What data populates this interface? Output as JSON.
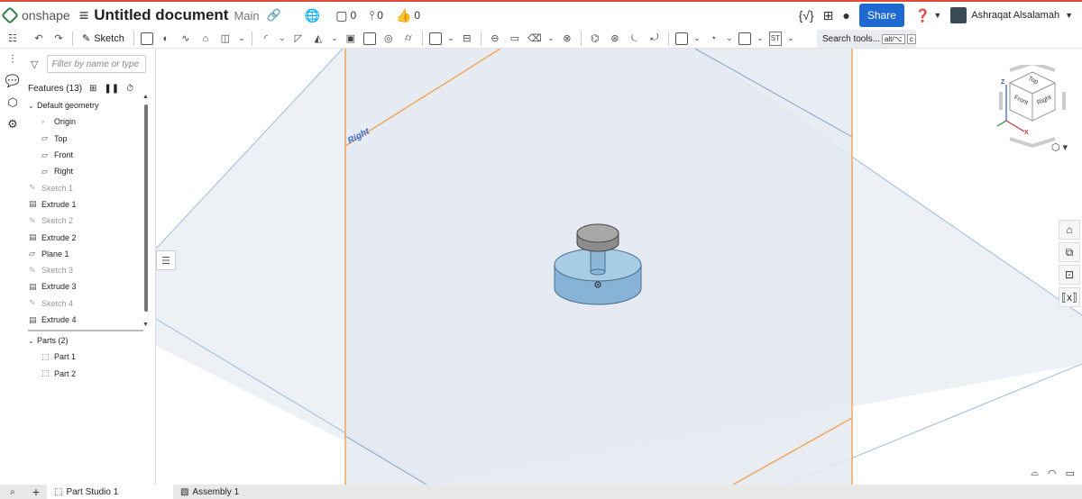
{
  "topbar": {
    "brand": "onshape",
    "doc_title": "Untitled document",
    "branch": "Main",
    "versions_count": "0",
    "branches_count": "0",
    "likes_count": "0",
    "share_label": "Share",
    "help_icon": "?",
    "user_name": "Ashraqat Alsalamah"
  },
  "toolbar": {
    "sketch_label": "Sketch",
    "search_label": "Search tools...",
    "search_kbd_1": "alt/⌥",
    "search_kbd_2": "c",
    "st_label": "ST"
  },
  "panel": {
    "filter_placeholder": "Filter by name or type",
    "features_label": "Features (13)",
    "default_geometry_label": "Default geometry",
    "default_items": [
      "Origin",
      "Top",
      "Front",
      "Right"
    ],
    "features": [
      {
        "label": "Sketch 1",
        "type": "sketch"
      },
      {
        "label": "Extrude 1",
        "type": "extrude"
      },
      {
        "label": "Sketch 2",
        "type": "sketch"
      },
      {
        "label": "Extrude 2",
        "type": "extrude"
      },
      {
        "label": "Plane 1",
        "type": "plane"
      },
      {
        "label": "Sketch 3",
        "type": "sketch"
      },
      {
        "label": "Extrude 3",
        "type": "extrude"
      },
      {
        "label": "Sketch 4",
        "type": "sketch"
      },
      {
        "label": "Extrude 4",
        "type": "extrude"
      }
    ],
    "parts_label": "Parts (2)",
    "parts": [
      "Part 1",
      "Part 2"
    ]
  },
  "viewport": {
    "plane_label": "Right",
    "cube_labels": {
      "top": "Top",
      "front": "Front",
      "right": "Right",
      "axis_z": "Z",
      "axis_x": "X"
    }
  },
  "tabs": [
    {
      "label": "Part Studio 1",
      "active": true
    },
    {
      "label": "Assembly 1",
      "active": false
    }
  ],
  "colors": {
    "accent": "#1e6ad2",
    "top_stripe": "#e04b3c",
    "plane_edge_orange": "#f0a65a",
    "plane_edge_blue": "#8fb2d8",
    "plane_fill": "#e9eef5",
    "part_base": "#8fb8d8",
    "part_knob": "#9a9a9a"
  }
}
